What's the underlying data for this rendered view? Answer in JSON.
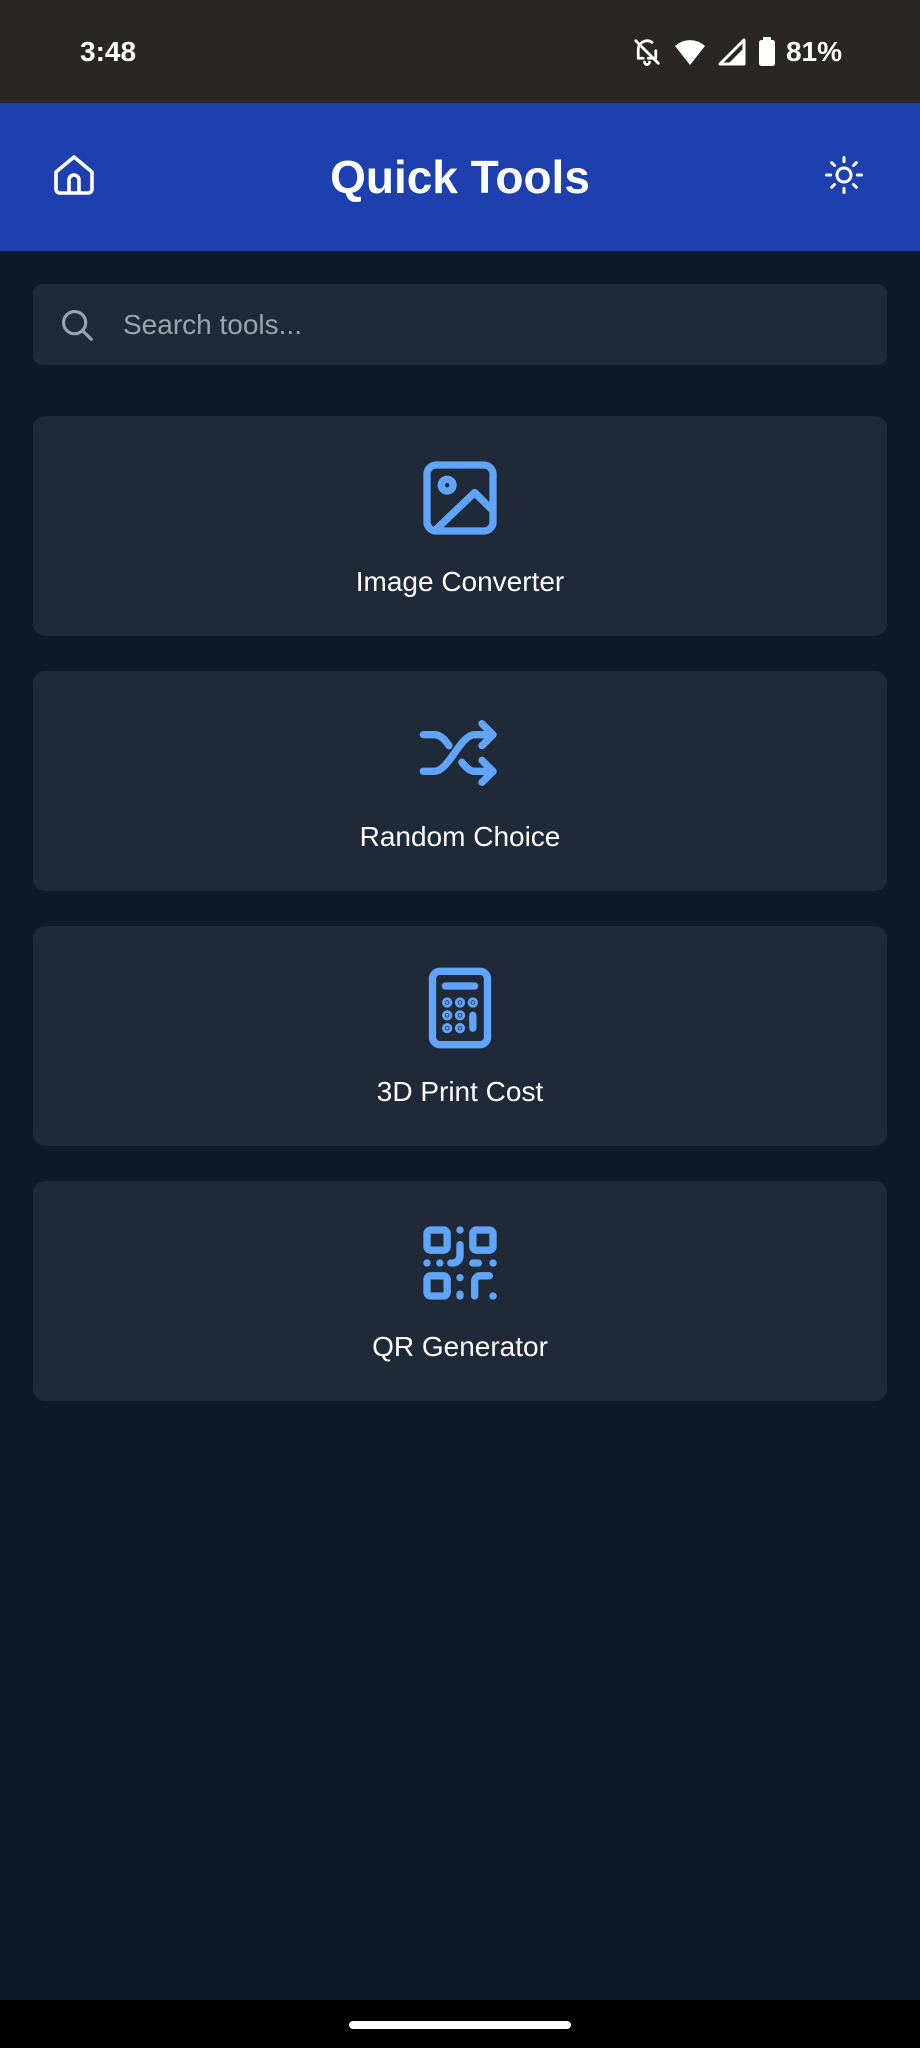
{
  "status_bar": {
    "time": "3:48",
    "battery_percent": "81%",
    "icons": [
      "mute-icon",
      "wifi-icon",
      "signal-icon",
      "battery-icon"
    ]
  },
  "header": {
    "title": "Quick Tools",
    "left_icon": "home-icon",
    "right_icon": "sun-icon"
  },
  "search": {
    "placeholder": "Search tools...",
    "value": ""
  },
  "tools": [
    {
      "label": "Image Converter",
      "icon": "image-icon"
    },
    {
      "label": "Random Choice",
      "icon": "shuffle-icon"
    },
    {
      "label": "3D Print Cost",
      "icon": "calculator-icon"
    },
    {
      "label": "QR Generator",
      "icon": "qr-code-icon"
    }
  ],
  "colors": {
    "background": "#111827",
    "header": "#1e40af",
    "card": "#1f2937",
    "accent": "#60a5fa",
    "status_bar": "#2a2626"
  }
}
